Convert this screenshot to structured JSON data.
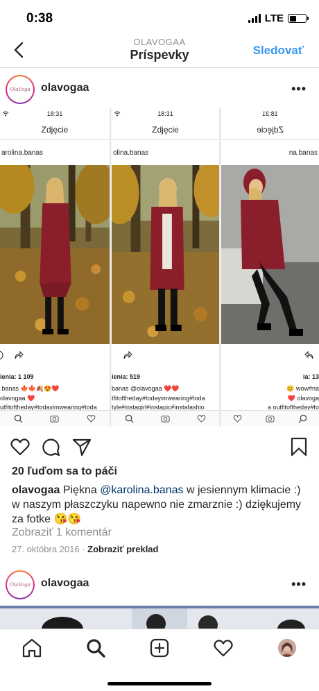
{
  "status_bar": {
    "time": "0:38",
    "network": "LTE",
    "battery_level": 0.45
  },
  "nav": {
    "subtitle": "OLAVOGAA",
    "title": "Príspevky",
    "follow_label": "Sledovať"
  },
  "post": {
    "author": "olavogaa",
    "avatar_text": "OlaVoga",
    "more_label": "•••",
    "panels": [
      {
        "time": "18:31",
        "title": "Zdjęcie",
        "user": "arolina.banas",
        "likes": "ienia: 1 109",
        "caption1": ".banas 🍁🍁🍂😍❤️",
        "caption2": "olavogaa ❤️",
        "caption3": "utfitoftheday#todayimwearing#toda"
      },
      {
        "time": "18:31",
        "title": "Zdjęcie",
        "user": "olina.banas",
        "likes": "ienia: 519",
        "caption1": "banas @olavogaa ❤️❤️",
        "caption2": "tfitoftheday#todayimwearing#toda",
        "caption3": "tyle#instagirl#instapic#instafashio"
      },
      {
        "time": "18:31",
        "title": "Zdjęcie",
        "user": "na.banas",
        "likes": "ia: 13",
        "caption1": "😊 wow#na",
        "caption2": "❤️ olavoga",
        "caption3": "a outfitoftheday#to"
      }
    ],
    "likes_text": "20 ľuďom sa to páči",
    "caption_user": "olavogaa",
    "caption_pre": "Piękna",
    "caption_mention": "@karolina.banas",
    "caption_post": "w jesiennym klimacie :) w naszym płaszczyku napewno nie zmarznie :) dziękujemy za fotke 😘😘",
    "view_comments": "Zobraziť 1 komentár",
    "date": "27. októbra 2016",
    "separator": "·",
    "translate": "Zobraziť preklad"
  },
  "next_post": {
    "author": "olavogaa",
    "avatar_text": "OlaVoga",
    "more_label": "•••"
  },
  "colors": {
    "accent": "#3897f0",
    "text": "#262626",
    "muted": "#8e8e8e",
    "mention": "#003569",
    "coat": "#8b1e2b"
  },
  "tabbar": {
    "items": [
      "home-icon",
      "search-icon",
      "new-post-icon",
      "activity-heart-icon",
      "profile-avatar"
    ]
  }
}
